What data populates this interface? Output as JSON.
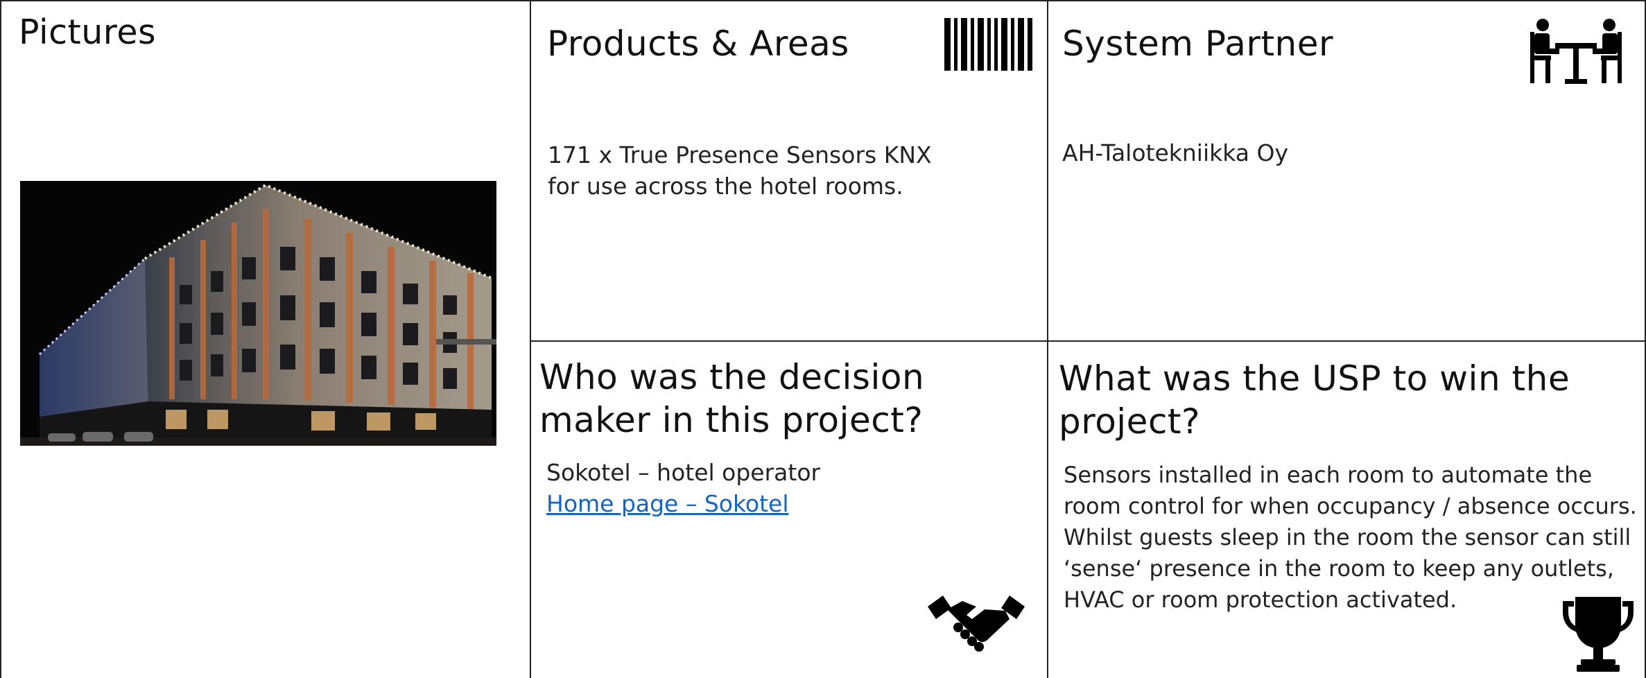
{
  "panels": {
    "pictures": {
      "title": "Pictures",
      "image_description": "hotel-building-photo"
    },
    "products": {
      "title": "Products & Areas",
      "lines": [
        "171 x True Presence Sensors KNX",
        "for use across the hotel rooms."
      ],
      "icon": "barcode-icon"
    },
    "partner": {
      "title": "System Partner",
      "lines": [
        "AH-Talotekniikka Oy"
      ],
      "icon": "meeting-people-icon"
    },
    "decision": {
      "title_lines": [
        "Who was the decision",
        "maker in this project?"
      ],
      "lines": [
        "Sokotel – hotel operator"
      ],
      "link_text": "Home page – Sokotel",
      "icon": "handshake-icon"
    },
    "usp": {
      "title_lines": [
        "What was the USP to win the",
        "project?"
      ],
      "lines": [
        "Sensors installed in each room to automate the",
        "room control for when occupancy / absence occurs.",
        "Whilst guests sleep in the room the sensor can still",
        "‘sense‘ presence in the room to keep any outlets,",
        "HVAC or room protection activated."
      ],
      "icon": "trophy-icon"
    }
  },
  "colors": {
    "border": "#222222",
    "link": "#1565c0",
    "text": "#1a1a1a"
  }
}
